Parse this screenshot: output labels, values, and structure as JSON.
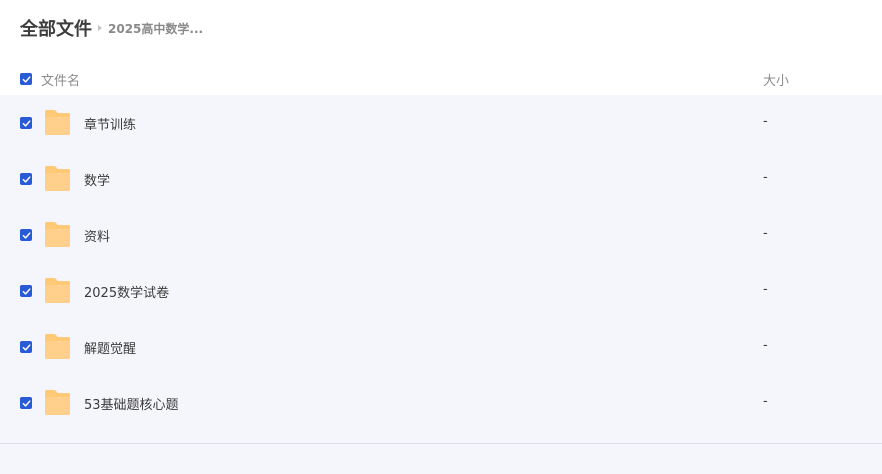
{
  "breadcrumb": {
    "root": "全部文件",
    "current": "2025高中数学..."
  },
  "table_header": {
    "name": "文件名",
    "size": "大小"
  },
  "files": [
    {
      "name": "章节训练",
      "size": "-"
    },
    {
      "name": "数学",
      "size": "-"
    },
    {
      "name": "资料",
      "size": "-"
    },
    {
      "name": "2025数学试卷",
      "size": "-"
    },
    {
      "name": "解题觉醒",
      "size": "-"
    },
    {
      "name": "53基础题核心题",
      "size": "-"
    }
  ],
  "colors": {
    "checkbox": "#2a5bd7",
    "folder": "#ffc978",
    "list_background": "#f5f6fc"
  },
  "icons": {
    "checkbox": "checkmark-icon",
    "folder": "folder-icon",
    "separator": "chevron-right-icon"
  }
}
